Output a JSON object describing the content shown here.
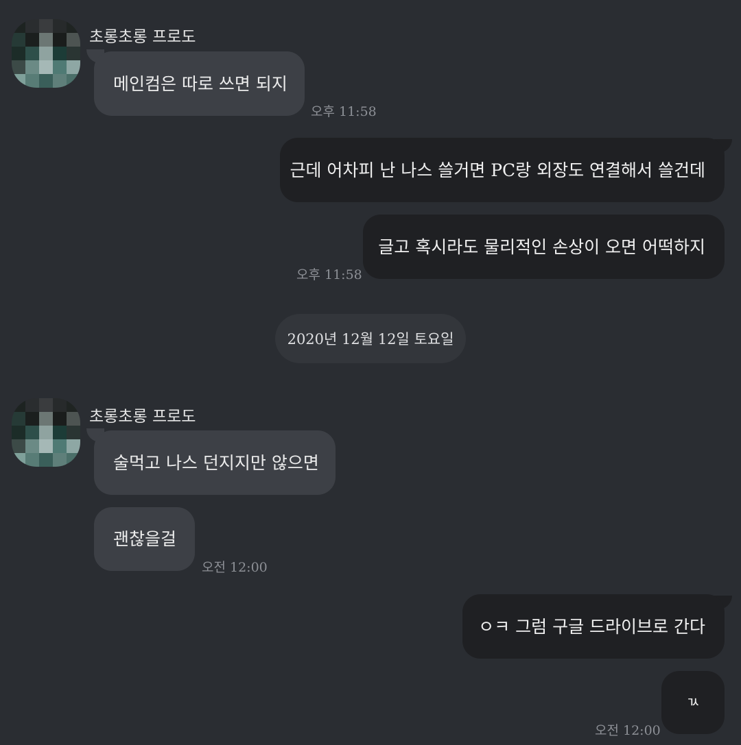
{
  "colors": {
    "background": "#2a2d32",
    "incoming_bubble": "#3d4046",
    "outgoing_bubble": "#1f2023",
    "timestamp": "#8d9096"
  },
  "sender_name": "초롱초롱 프로도",
  "messages": [
    {
      "text": "메인컴은 따로 쓰면 되지"
    },
    {
      "text": "근데 어차피 난 나스 쓸거면 PC랑 외장도 연결해서 쓸건데"
    },
    {
      "text": "글고 혹시라도 물리적인 손상이 오면 어떡하지"
    },
    {
      "text": "술먹고 나스 던지지만 않으면"
    },
    {
      "text": "괜찮을걸"
    },
    {
      "text": "ㅇㅋ 그럼 구글 드라이브로 간다"
    },
    {
      "text": "ㄳ"
    }
  ],
  "times": [
    "오후 11:58",
    "오후 11:58",
    "오전 12:00",
    "오전 12:00"
  ],
  "date_divider": "2020년 12월 12일 토요일"
}
